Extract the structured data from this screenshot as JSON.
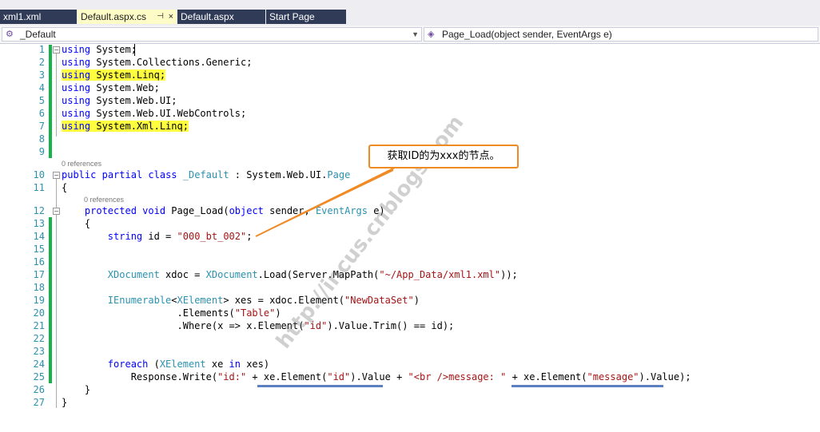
{
  "tabs": [
    {
      "label": "xml1.xml",
      "active": false
    },
    {
      "label": "Default.aspx.cs",
      "active": true,
      "pin": "⊣",
      "close": "×"
    },
    {
      "label": "Default.aspx",
      "active": false
    },
    {
      "label": "Start Page",
      "active": false
    }
  ],
  "nav": {
    "class_dropdown": "_Default",
    "member_dropdown": "Page_Load(object sender, EventArgs e)",
    "dropdown_arrow": "▼",
    "class_icon": "class-icon",
    "member_icon": "method-icon"
  },
  "code": {
    "line_numbers": [
      "1",
      "2",
      "3",
      "4",
      "5",
      "6",
      "7",
      "8",
      "9",
      "10",
      "11",
      "12",
      "13",
      "14",
      "15",
      "16",
      "17",
      "18",
      "19",
      "20",
      "21",
      "22",
      "23",
      "24",
      "25",
      "26",
      "27"
    ],
    "lines": [
      "using System;",
      "using System.Collections.Generic;",
      "using System.Linq;",
      "using System.Web;",
      "using System.Web.UI;",
      "using System.Web.UI.WebControls;",
      "using System.Xml.Linq;",
      "",
      "",
      "public partial class _Default : System.Web.UI.Page",
      "{",
      "    protected void Page_Load(object sender, EventArgs e)",
      "    {",
      "        string id = \"000_bt_002\";",
      "",
      "",
      "        XDocument xdoc = XDocument.Load(Server.MapPath(\"~/App_Data/xml1.xml\"));",
      "",
      "        IEnumerable<XElement> xes = xdoc.Element(\"NewDataSet\")",
      "                    .Elements(\"Table\")",
      "                    .Where(x => x.Element(\"id\").Value.Trim() == id);",
      "",
      "",
      "        foreach (XElement xe in xes)",
      "            Response.Write(\"id:\" + xe.Element(\"id\").Value + \"<br />message: \" + xe.Element(\"message\").Value);",
      "    }",
      "}"
    ],
    "references_label": "0 references",
    "fold_collapse": "−"
  },
  "annotation": {
    "callout_text": "获取ID的为xxx的节点。",
    "watermark": "http://incus.cnblogs.com"
  },
  "colors": {
    "keyword": "#0000ff",
    "type": "#2b91af",
    "string": "#a31515",
    "highlight": "#ffff40",
    "change_bar": "#17b34a",
    "callout_border": "#f08a24",
    "underline": "#5b7fc0"
  }
}
